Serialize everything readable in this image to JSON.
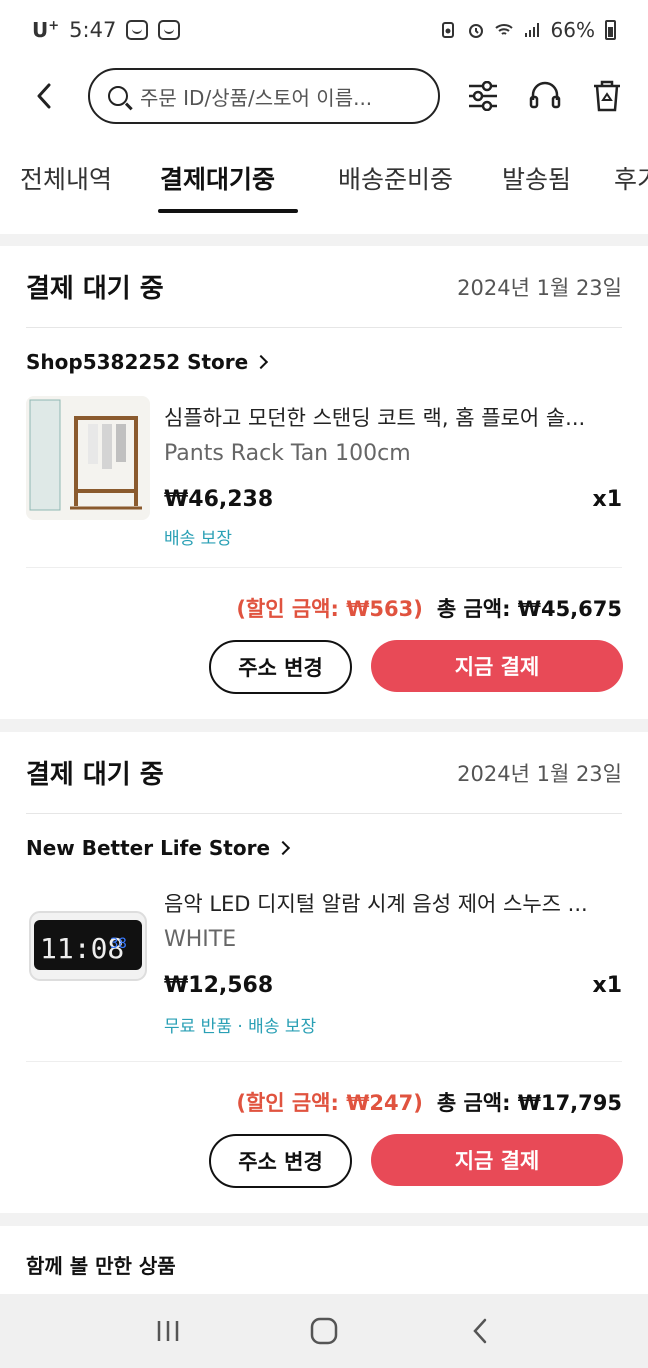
{
  "status_bar": {
    "carrier": "U",
    "carrier_sup": "+",
    "time": "5:47",
    "battery": "66%"
  },
  "search": {
    "placeholder": "주문 ID/상품/스토어 이름..."
  },
  "tabs": [
    {
      "label": "전체내역",
      "active": false
    },
    {
      "label": "결제대기중",
      "active": true
    },
    {
      "label": "배송준비중",
      "active": false
    },
    {
      "label": "발송됨",
      "active": false
    },
    {
      "label": "후기",
      "active": false
    }
  ],
  "orders": [
    {
      "status": "결제 대기 중",
      "date": "2024년 1월 23일",
      "store": "Shop5382252 Store",
      "product_name": "심플하고 모던한 스탠딩 코트 랙, 홈 플로어 솔...",
      "variant": "Pants Rack Tan 100cm",
      "price": "₩46,238",
      "qty": "x1",
      "tag": "배송 보장",
      "discount": "(할인 금액: ₩563)",
      "total": "총 금액: ₩45,675",
      "btn_address": "주소 변경",
      "btn_pay": "지금 결제"
    },
    {
      "status": "결제 대기 중",
      "date": "2024년 1월 23일",
      "store": "New Better Life Store",
      "product_name": "음악 LED 디지털 알람 시계 음성 제어 스누즈 ...",
      "variant": "WHITE",
      "price": "₩12,568",
      "qty": "x1",
      "tag": "무료 반품 · 배송 보장",
      "discount": "(할인 금액: ₩247)",
      "total": "총 금액: ₩17,795",
      "btn_address": "주소 변경",
      "btn_pay": "지금 결제",
      "clock_time": "11:08",
      "clock_side": "38"
    }
  ],
  "recommend": {
    "title": "함께 볼 만한 상품"
  },
  "colors": {
    "pay_button": "#e84a57",
    "discount": "#e0533f",
    "tag": "#2aa0b5"
  }
}
